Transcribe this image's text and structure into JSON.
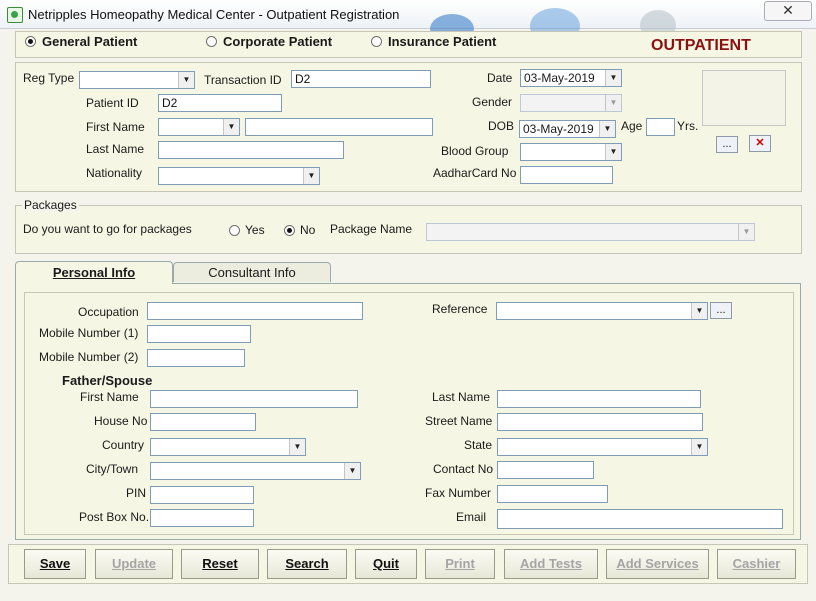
{
  "window": {
    "title": "Netripples Homeopathy Medical Center - Outpatient Registration",
    "close": "✕"
  },
  "patient_type": {
    "options": [
      "General Patient",
      "Corporate Patient",
      "Insurance Patient"
    ],
    "selected": "General Patient",
    "mode_label": "OUTPATIENT"
  },
  "registration": {
    "reg_type_label": "Reg Type",
    "reg_type_value": "",
    "transaction_id_label": "Transaction ID",
    "transaction_id_value": "D2",
    "date_label": "Date",
    "date_value": "03-May-2019",
    "patient_id_label": "Patient ID",
    "patient_id_value": "D2",
    "gender_label": "Gender",
    "gender_value": "",
    "first_name_label": "First Name",
    "first_name_value": "",
    "dob_label": "DOB",
    "dob_value": "03-May-2019",
    "age_label": "Age",
    "age_value": "",
    "yrs_label": "Yrs.",
    "last_name_label": "Last Name",
    "last_name_value": "",
    "blood_group_label": "Blood Group",
    "blood_group_value": "",
    "nationality_label": "Nationality",
    "nationality_value": "",
    "aadhar_label": "AadharCard No",
    "aadhar_value": "",
    "browse_label": "...",
    "remove_label": "✕"
  },
  "packages": {
    "legend": "Packages",
    "question": "Do you want to go for packages",
    "yes_label": "Yes",
    "no_label": "No",
    "selected": "No",
    "package_name_label": "Package Name",
    "package_name_value": ""
  },
  "tabs": [
    {
      "label": "Personal Info",
      "active": true
    },
    {
      "label": "Consultant Info",
      "active": false
    }
  ],
  "personal": {
    "occupation_label": "Occupation",
    "occupation_value": "",
    "mobile1_label": "Mobile Number (1)",
    "mobile1_value": "",
    "mobile2_label": "Mobile Number (2)",
    "mobile2_value": "",
    "reference_label": "Reference",
    "reference_value": "",
    "reference_browse": "...",
    "father_spouse_heading": "Father/Spouse",
    "fs_first_name_label": "First Name",
    "fs_first_name_value": "",
    "fs_last_name_label": "Last Name",
    "fs_last_name_value": "",
    "house_no_label": "House No",
    "house_no_value": "",
    "street_name_label": "Street Name",
    "street_name_value": "",
    "country_label": "Country",
    "country_value": "",
    "state_label": "State",
    "state_value": "",
    "city_label": "City/Town",
    "city_value": "",
    "contact_no_label": "Contact No",
    "contact_no_value": "",
    "pin_label": "PIN",
    "pin_value": "",
    "fax_label": "Fax Number",
    "fax_value": "",
    "post_box_label": "Post Box No.",
    "post_box_value": "",
    "email_label": "Email",
    "email_value": ""
  },
  "buttons": {
    "save": "Save",
    "update": "Update",
    "reset": "Reset",
    "search": "Search",
    "quit": "Quit",
    "print": "Print",
    "add_tests": "Add Tests",
    "add_services": "Add Services",
    "cashier": "Cashier"
  },
  "colors": {
    "accent_red": "#8b1010",
    "panel_bg": "#f6f6e4",
    "field_border": "#7f9db9"
  }
}
